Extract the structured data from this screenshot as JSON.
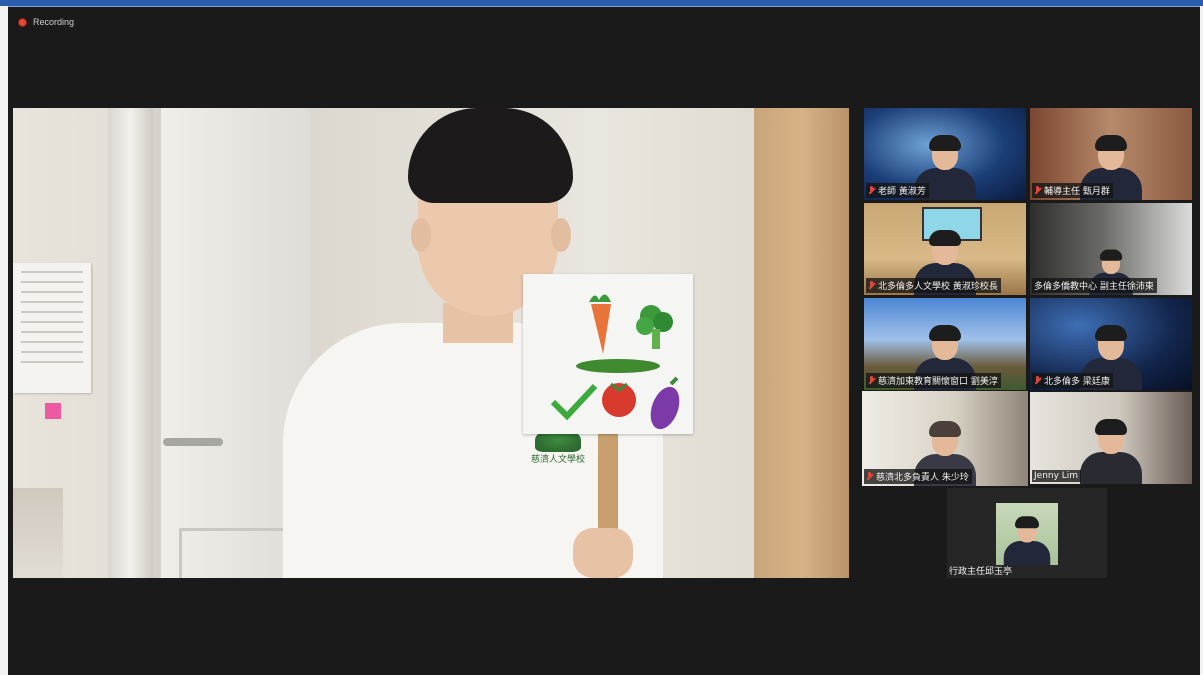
{
  "recording": {
    "label": "Recording"
  },
  "main_video": {
    "logo_text": "慈濟人文學校"
  },
  "gallery": [
    {
      "name": "老師 黃淑芳",
      "muted": true
    },
    {
      "name": "輔導主任 甄月群",
      "muted": true
    },
    {
      "name": "北多倫多人文學校 黃淑珍校長",
      "muted": true
    },
    {
      "name": "多倫多僑教中心 副主任徐沛東",
      "muted": false
    },
    {
      "name": "慈濟加東教育關懷窗口 劉美淳",
      "muted": true
    },
    {
      "name": "北多倫多 梁廷康",
      "muted": true
    },
    {
      "name": "慈濟北多負責人 朱少玲",
      "muted": true,
      "active_speaker": true
    },
    {
      "name": "Jenny Lim",
      "muted": false
    }
  ],
  "last_participant": {
    "name": "行政主任邱玉亭"
  },
  "colors": {
    "active_border": "#c9d65a",
    "mute_red": "#e0483c",
    "recording_red": "#e24b3c"
  }
}
